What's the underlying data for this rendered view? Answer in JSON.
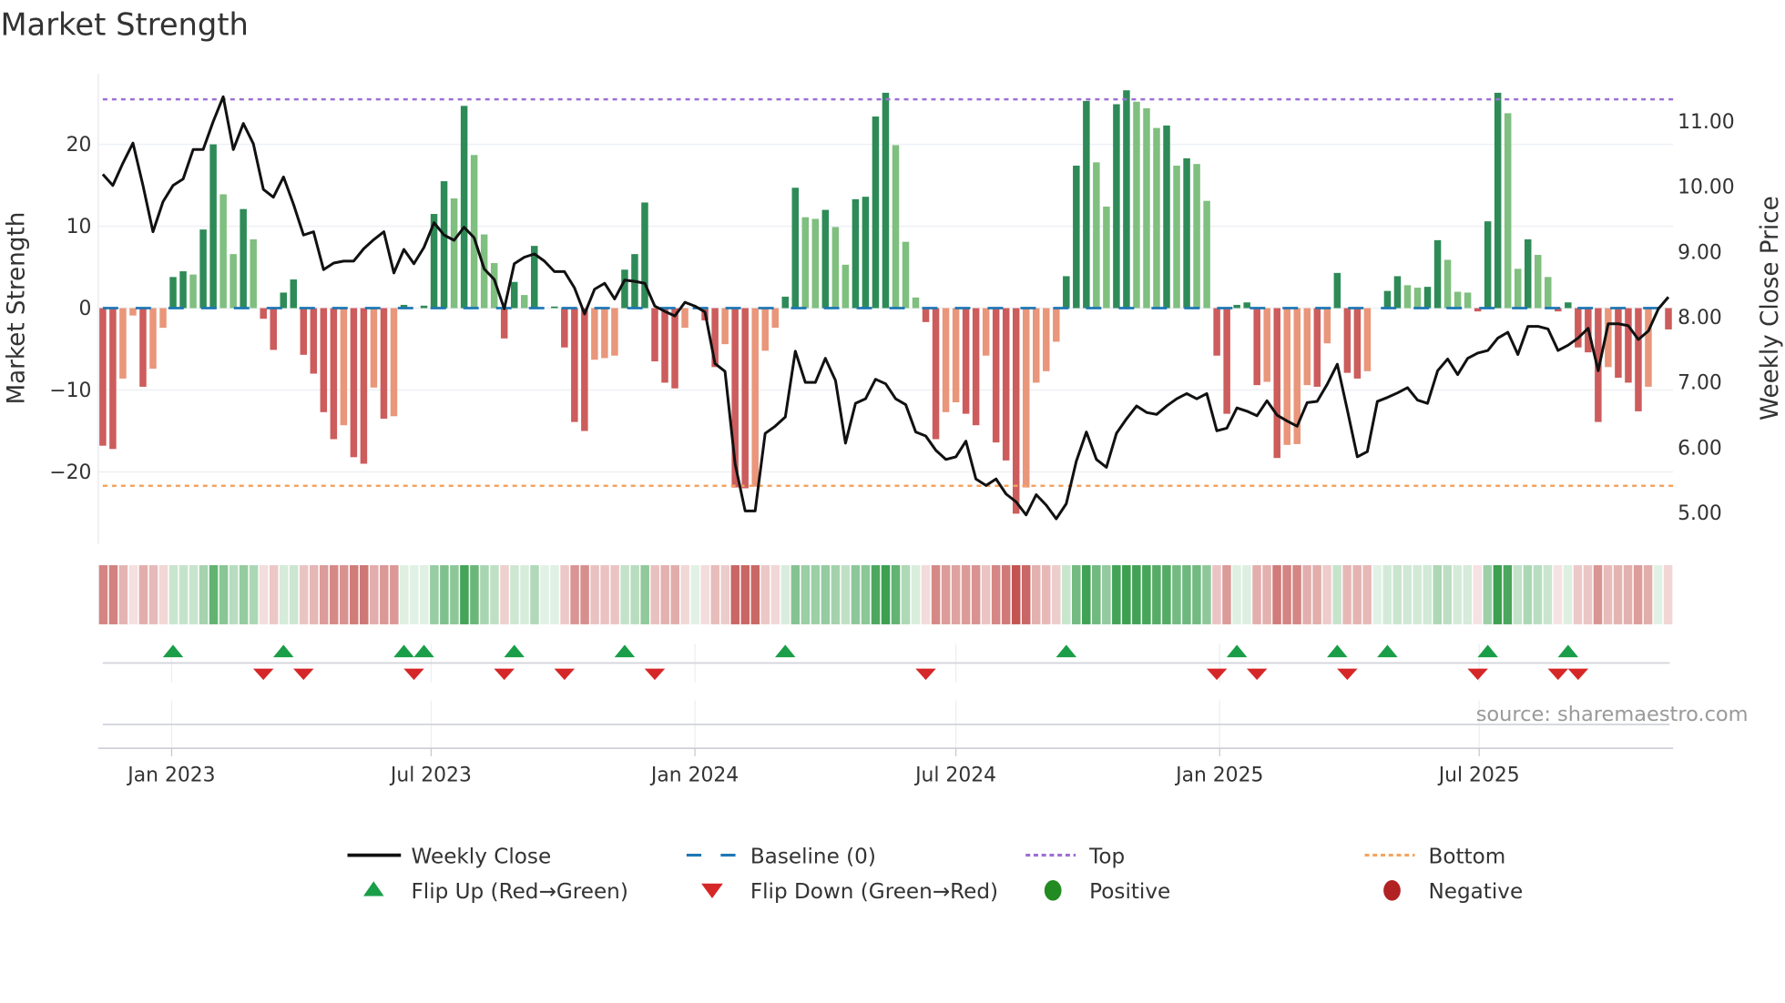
{
  "title": "Market Strength",
  "source": "source: sharemaestro.com",
  "colors": {
    "pos_strong": "#2e8b57",
    "pos_weak": "#7fbf7f",
    "neg_strong": "#cd5c5c",
    "neg_weak": "#e9967a",
    "line": "#111111",
    "baseline": "#1f77b4",
    "top": "#9d6fd6",
    "bottom": "#f4a460",
    "flip_up": "#1a9e48",
    "flip_down": "#d62728",
    "positive": "#228b22",
    "negative": "#b22222",
    "heat_pos": "#3ca050",
    "heat_neg": "#c0504d"
  },
  "chart_data": {
    "type": "bar",
    "title": "Market Strength",
    "frequency": "weekly",
    "start_date": "2022-11-14",
    "ylabel": "Market Strength",
    "ylabel_right": "Weekly Close Price",
    "ylim": [
      -28.75,
      28.6
    ],
    "ylim_right": [
      4.53,
      11.73
    ],
    "grid": true,
    "left_ticks": [
      {
        "v": 20,
        "label": "20"
      },
      {
        "v": 10,
        "label": "10"
      },
      {
        "v": 0,
        "label": "0"
      },
      {
        "v": -10,
        "label": "−10"
      },
      {
        "v": -20,
        "label": "−20"
      }
    ],
    "right_ticks": [
      {
        "v": 11,
        "label": "11.00"
      },
      {
        "v": 10,
        "label": "10.00"
      },
      {
        "v": 9,
        "label": "9.00"
      },
      {
        "v": 8,
        "label": "8.00"
      },
      {
        "v": 7,
        "label": "7.00"
      },
      {
        "v": 6,
        "label": "6.00"
      },
      {
        "v": 5,
        "label": "5.00"
      }
    ],
    "x_ticks": [
      {
        "date": "2023-01-01",
        "label": "Jan 2023"
      },
      {
        "date": "2023-07-01",
        "label": "Jul 2023"
      },
      {
        "date": "2024-01-01",
        "label": "Jan 2024"
      },
      {
        "date": "2024-07-01",
        "label": "Jul 2024"
      },
      {
        "date": "2025-01-01",
        "label": "Jan 2025"
      },
      {
        "date": "2025-07-01",
        "label": "Jul 2025"
      }
    ],
    "top_level": 25.5,
    "bottom_level": -21.7,
    "baseline": 0,
    "strength": [
      -16.8,
      -17.2,
      -8.6,
      -0.9,
      -9.6,
      -7.4,
      -2.4,
      3.8,
      4.5,
      4.1,
      9.6,
      20,
      13.9,
      6.6,
      12.1,
      8.4,
      -1.3,
      -5.1,
      1.9,
      3.5,
      -5.7,
      -8.0,
      -12.7,
      -16.0,
      -14.3,
      -18.2,
      -19.0,
      -9.7,
      -13.5,
      -13.2,
      0.4,
      0,
      0.3,
      11.5,
      15.5,
      13.4,
      24.7,
      18.7,
      9.0,
      5.5,
      -3.7,
      3.2,
      1.6,
      7.6,
      0,
      0.2,
      -4.8,
      -13.9,
      -15.0,
      -6.3,
      -6.1,
      -5.8,
      4.7,
      6.6,
      12.9,
      -6.5,
      -9.1,
      -9.8,
      -2.4,
      0,
      -1.5,
      -7.2,
      -4.4,
      -21.9,
      -22.0,
      -21.8,
      -5.2,
      -2.4,
      1.4,
      14.7,
      11.1,
      10.9,
      12.0,
      9.9,
      5.3,
      13.3,
      13.6,
      23.4,
      26.3,
      19.9,
      8.1,
      1.3,
      -1.7,
      -16.0,
      -12.7,
      -11.5,
      -12.9,
      -14.3,
      -5.8,
      -16.4,
      -18.6,
      -25.1,
      -21.9,
      -9.1,
      -7.7,
      -4.1,
      3.9,
      17.4,
      25.3,
      17.8,
      12.4,
      24.9,
      26.6,
      25.2,
      24.4,
      22.0,
      22.3,
      17.4,
      18.3,
      17.6,
      13.1,
      -5.8,
      -12.9,
      0.4,
      0.7,
      -9.4,
      -9.0,
      -18.3,
      -16.7,
      -16.6,
      -9.4,
      -9.6,
      -4.3,
      4.3,
      -7.9,
      -8.6,
      -7.7,
      0,
      2.1,
      3.9,
      2.8,
      2.5,
      2.6,
      8.3,
      5.9,
      2.0,
      1.9,
      -0.4,
      10.6,
      26.3,
      23.8,
      4.8,
      8.4,
      6.5,
      3.8,
      -0.4,
      0.7,
      -4.8,
      -5.4,
      -13.9,
      -7.2,
      -8.5,
      -9.1,
      -12.6,
      -9.6,
      0,
      -2.6
    ],
    "weekly_close": [
      10.19,
      10.02,
      10.36,
      10.67,
      10.02,
      9.31,
      9.77,
      10.02,
      10.12,
      10.57,
      10.57,
      11.0,
      11.38,
      10.57,
      10.97,
      10.66,
      9.96,
      9.84,
      10.15,
      9.73,
      9.26,
      9.31,
      8.73,
      8.83,
      8.86,
      8.86,
      9.05,
      9.19,
      9.31,
      8.68,
      9.04,
      8.82,
      9.07,
      9.45,
      9.26,
      9.18,
      9.38,
      9.22,
      8.74,
      8.58,
      8.13,
      8.82,
      8.92,
      8.97,
      8.86,
      8.7,
      8.7,
      8.45,
      8.05,
      8.43,
      8.52,
      8.28,
      8.57,
      8.55,
      8.52,
      8.17,
      8.09,
      8.02,
      8.23,
      8.17,
      8.08,
      7.29,
      7.17,
      5.75,
      5.03,
      5.03,
      6.22,
      6.33,
      6.47,
      7.48,
      7.0,
      7.0,
      7.37,
      7.03,
      6.07,
      6.68,
      6.75,
      7.05,
      6.98,
      6.75,
      6.66,
      6.24,
      6.18,
      5.96,
      5.82,
      5.86,
      6.1,
      5.52,
      5.42,
      5.52,
      5.29,
      5.17,
      4.97,
      5.28,
      5.12,
      4.91,
      5.14,
      5.79,
      6.24,
      5.82,
      5.7,
      6.22,
      6.44,
      6.64,
      6.54,
      6.51,
      6.64,
      6.75,
      6.83,
      6.75,
      6.83,
      6.26,
      6.3,
      6.61,
      6.56,
      6.49,
      6.72,
      6.5,
      6.41,
      6.33,
      6.69,
      6.71,
      6.97,
      7.28,
      6.58,
      5.86,
      5.94,
      6.71,
      6.77,
      6.84,
      6.92,
      6.73,
      6.68,
      7.18,
      7.36,
      7.12,
      7.37,
      7.45,
      7.49,
      7.68,
      7.77,
      7.43,
      7.86,
      7.86,
      7.82,
      7.49,
      7.57,
      7.68,
      7.83,
      7.18,
      7.9,
      7.9,
      7.87,
      7.66,
      7.79,
      8.13,
      8.31
    ],
    "flip_up_weeks": [
      8,
      19,
      31,
      33,
      42,
      53,
      69,
      97,
      114,
      124,
      129,
      139,
      147
    ],
    "flip_down_weeks": [
      17,
      21,
      32,
      41,
      47,
      56,
      83,
      112,
      116,
      125,
      138,
      146,
      148
    ],
    "legend_position": "bottom",
    "legend": [
      {
        "label": "Weekly Close",
        "kind": "line"
      },
      {
        "label": "Baseline (0)",
        "kind": "dash"
      },
      {
        "label": "Top",
        "kind": "dot-top"
      },
      {
        "label": "Bottom",
        "kind": "dot-bottom"
      },
      {
        "label": "Flip Up (Red→Green)",
        "kind": "tri-up"
      },
      {
        "label": "Flip Down (Green→Red)",
        "kind": "tri-down"
      },
      {
        "label": "Positive",
        "kind": "dot-pos"
      },
      {
        "label": "Negative",
        "kind": "dot-neg"
      }
    ]
  }
}
